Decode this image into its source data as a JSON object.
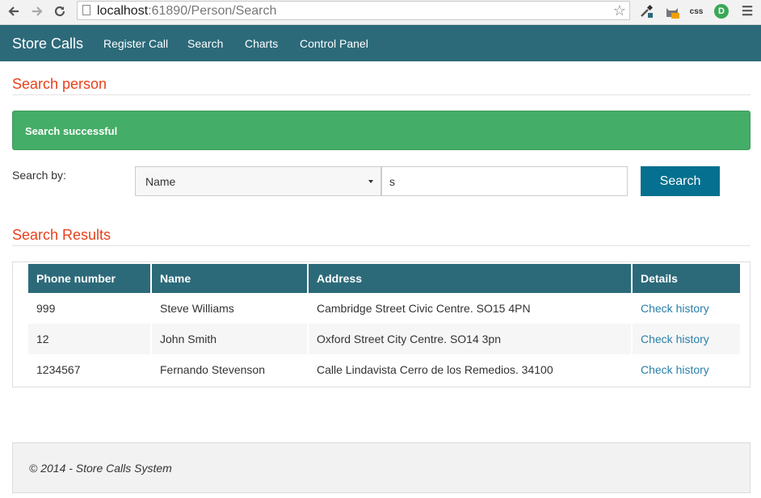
{
  "browser": {
    "url_host": "localhost",
    "url_path": ":61890/Person/Search",
    "icons": [
      "back-arrow-icon",
      "forward-arrow-icon",
      "reload-icon",
      "bookmark-star-icon",
      "eyedropper-icon",
      "cat-extension-icon",
      "css-extension-icon",
      "green-extension-icon",
      "menu-icon"
    ],
    "ext_css_label": "css",
    "ext_green_label": "D"
  },
  "navbar": {
    "brand": "Store Calls",
    "links": [
      "Register Call",
      "Search",
      "Charts",
      "Control Panel"
    ]
  },
  "page": {
    "title": "Search person",
    "alert": "Search successful",
    "search_label": "Search by:",
    "search_by_selected": "Name",
    "search_value": "s",
    "search_button": "Search",
    "results_title": "Search Results"
  },
  "results": {
    "headers": [
      "Phone number",
      "Name",
      "Address",
      "Details"
    ],
    "rows": [
      {
        "phone": "999",
        "name": "Steve Williams",
        "address": "Cambridge Street Civic Centre. SO15 4PN",
        "details": "Check history"
      },
      {
        "phone": "12",
        "name": "John Smith",
        "address": "Oxford Street City Centre. SO14 3pn",
        "details": "Check history"
      },
      {
        "phone": "1234567",
        "name": "Fernando Stevenson",
        "address": "Calle Lindavista Cerro de los Remedios. 34100",
        "details": "Check history"
      }
    ]
  },
  "footer": {
    "text": "© 2014 - Store Calls System"
  },
  "colors": {
    "navbar": "#2c6a7a",
    "heading": "#e8401b",
    "alert": "#44ad67",
    "button": "#05708f",
    "link": "#2a7fa8"
  }
}
